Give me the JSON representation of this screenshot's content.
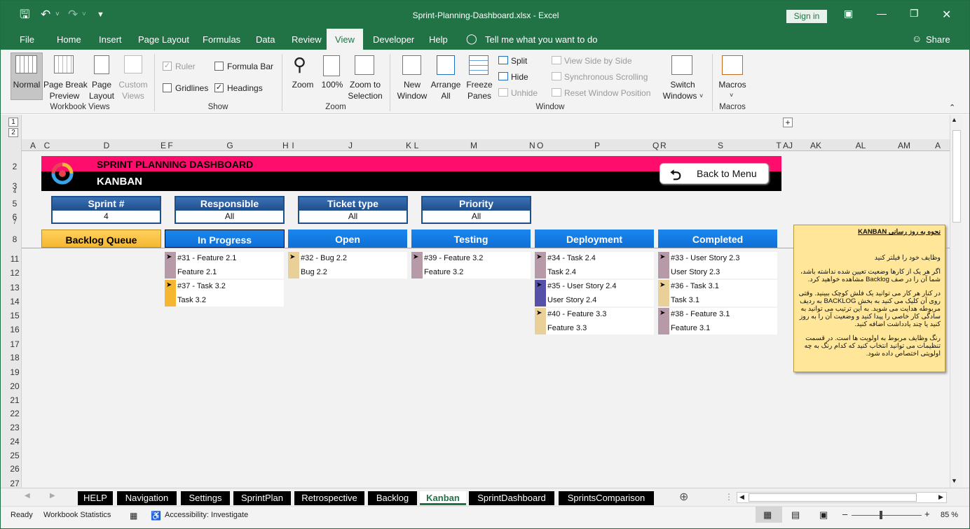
{
  "window": {
    "title": "Sprint-Planning-Dashboard.xlsx  -  Excel",
    "sign_in": "Sign in"
  },
  "ribbon_tabs": [
    "File",
    "Home",
    "Insert",
    "Page Layout",
    "Formulas",
    "Data",
    "Review",
    "View",
    "Developer",
    "Help"
  ],
  "tell_me": "Tell me what you want to do",
  "share": "Share",
  "ribbon": {
    "workbook_views": {
      "normal": "Normal",
      "page_break_1": "Page Break",
      "page_break_2": "Preview",
      "page_layout_1": "Page",
      "page_layout_2": "Layout",
      "custom_1": "Custom",
      "custom_2": "Views",
      "group": "Workbook Views"
    },
    "show": {
      "ruler": "Ruler",
      "formula_bar": "Formula Bar",
      "gridlines": "Gridlines",
      "headings": "Headings",
      "group": "Show"
    },
    "zoom": {
      "zoom": "Zoom",
      "hundred": "100%",
      "zoom_sel_1": "Zoom to",
      "zoom_sel_2": "Selection",
      "group": "Zoom"
    },
    "window": {
      "new_1": "New",
      "new_2": "Window",
      "arrange_1": "Arrange",
      "arrange_2": "All",
      "freeze_1": "Freeze",
      "freeze_2": "Panes",
      "split": "Split",
      "hide": "Hide",
      "unhide": "Unhide",
      "side_by_side": "View Side by Side",
      "sync_scroll": "Synchronous Scrolling",
      "reset_pos": "Reset Window Position",
      "switch_1": "Switch",
      "switch_2": "Windows",
      "group": "Window"
    },
    "macros": {
      "macros": "Macros",
      "group": "Macros"
    }
  },
  "columns": [
    "A",
    "C",
    "D",
    "E",
    "F",
    "G",
    "H",
    "I",
    "J",
    "K",
    "L",
    "M",
    "N",
    "O",
    "P",
    "Q",
    "R",
    "S",
    "T",
    "AJ",
    "AK",
    "AL",
    "AM",
    "A"
  ],
  "rows": [
    "1",
    "2",
    "3",
    "4",
    "5",
    "6",
    "7",
    "8",
    "11",
    "12",
    "13",
    "14",
    "15",
    "16",
    "17",
    "18",
    "19",
    "20",
    "21",
    "22",
    "23",
    "24",
    "25",
    "26",
    "27"
  ],
  "dashboard": {
    "title": "SPRINT PLANNING DASHBOARD",
    "subtitle": "KANBAN",
    "back_button": "Back to Menu",
    "filters": [
      {
        "label": "Sprint #",
        "value": "4"
      },
      {
        "label": "Responsible",
        "value": "All"
      },
      {
        "label": "Ticket type",
        "value": "All"
      },
      {
        "label": "Priority",
        "value": "All"
      }
    ],
    "columns": [
      {
        "title": "Backlog Queue",
        "cards": []
      },
      {
        "title": "In Progress",
        "cards": [
          {
            "line1": "#31 - Feature 2.1",
            "line2": "Feature 2.1",
            "color": "#b79aa8"
          },
          {
            "line1": "#37 - Task 3.2",
            "line2": "Task 3.2",
            "color": "#f5b731"
          }
        ]
      },
      {
        "title": "Open",
        "cards": [
          {
            "line1": "#32 - Bug 2.2",
            "line2": "Bug 2.2",
            "color": "#e9cf98"
          }
        ]
      },
      {
        "title": "Testing",
        "cards": [
          {
            "line1": "#39 - Feature 3.2",
            "line2": "Feature 3.2",
            "color": "#b79aa8"
          }
        ]
      },
      {
        "title": "Deployment",
        "cards": [
          {
            "line1": "#34 - Task 2.4",
            "line2": "Task 2.4",
            "color": "#b79aa8"
          },
          {
            "line1": "#35 - User Story 2.4",
            "line2": "User Story 2.4",
            "color": "#5750a8"
          },
          {
            "line1": "#40 - Feature 3.3",
            "line2": "Feature 3.3",
            "color": "#e9cf98"
          }
        ]
      },
      {
        "title": "Completed",
        "cards": [
          {
            "line1": "#33 - User Story 2.3",
            "line2": "User Story 2.3",
            "color": "#b79aa8"
          },
          {
            "line1": "#36 - Task 3.1",
            "line2": "Task 3.1",
            "color": "#e9cf98"
          },
          {
            "line1": "#38 - Feature 3.1",
            "line2": "Feature 3.1",
            "color": "#b79aa8"
          }
        ]
      }
    ],
    "help": {
      "title": "نحوه به روز رسانی KANBAN",
      "p1": "وظایف خود را فیلتر کنید",
      "p2": "اگر هر یک از کارها وضعیت تعیین شده نداشته باشد، شما آن را در صف Backlog مشاهده خواهید کرد.",
      "p3": "در کنار هر کار می توانید یک فلش کوچک ببینید. وقتی روی آن کلیک می کنید به بخش BACKLOG به ردیف مربوطه هدایت می شوید. به این ترتیب می توانید به سادگی کار خاصی را پیدا کنید و وضعیت آن را به روز کنید یا چند یادداشت اضافه کنید.",
      "p4": "رنگ وظایف مربوط به اولویت ها است. در قسمت تنظیمات می توانید انتخاب کنید که کدام رنگ به چه اولویتی اختصاص داده شود."
    }
  },
  "sheet_tabs": [
    "HELP",
    "Navigation",
    "Settings",
    "SprintPlan",
    "Retrospective",
    "Backlog",
    "Kanban",
    "SprintDashboard",
    "SprintsComparison"
  ],
  "status": {
    "ready": "Ready",
    "workbook_stats": "Workbook Statistics",
    "accessibility": "Accessibility: Investigate",
    "zoom": "85 %"
  },
  "colors": {
    "excel_green": "#217346",
    "pink": "#ff0d6c",
    "column_blue": "#1a86ef",
    "backlog_orange": "#f5b731"
  }
}
